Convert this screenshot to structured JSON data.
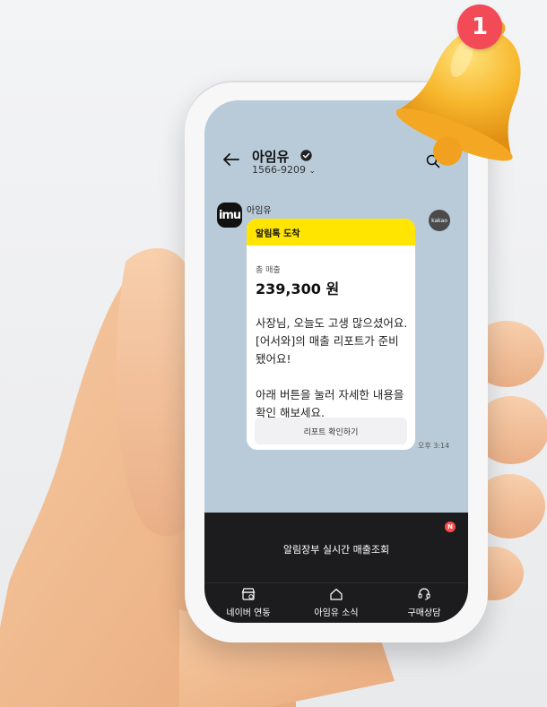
{
  "chat": {
    "name": "아임유",
    "phone": "1566-9209",
    "sender": "아임유",
    "avatar_text": "imu",
    "kakao_badge": "kakao"
  },
  "message": {
    "header": "알림톡 도착",
    "total_label": "총 매출",
    "total_value": "239,300 원",
    "body_line1": "사장님, 오늘도 고생 많으셨어요. [어서와]의 매출 리포트가 준비 됐어요!",
    "body_line2": "아래 버튼을 눌러 자세한 내용을 확인 해보세요.",
    "button": "리포트 확인하기",
    "time": "오후 3:14"
  },
  "bottom_menu": {
    "title": "알림장부 실시간 매출조회",
    "new_badge": "N",
    "items": [
      {
        "label": "네이버 연동",
        "icon": "store-icon"
      },
      {
        "label": "아임유 소식",
        "icon": "home-icon"
      },
      {
        "label": "구매상담",
        "icon": "headset-icon"
      }
    ]
  },
  "notification": {
    "count": "1"
  },
  "colors": {
    "kakao_yellow": "#ffe500",
    "chat_bg": "#b9cbd9",
    "panel_bg": "#1c1c1e",
    "badge_red": "#f24a57"
  }
}
